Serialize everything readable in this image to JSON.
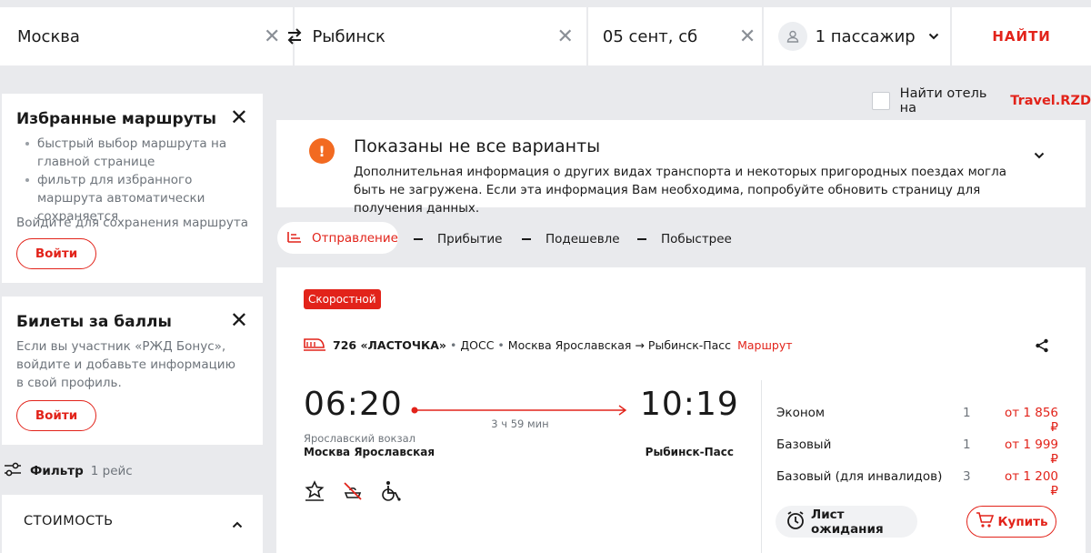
{
  "search": {
    "from": "Москва",
    "to": "Рыбинск",
    "date": "05 сент, сб",
    "passengers": "1 пассажир",
    "find_label": "НАЙТИ"
  },
  "hotel": {
    "label_prefix": "Найти отель на ",
    "brand": "Travel.RZD"
  },
  "favorites": {
    "title": "Избранные маршруты",
    "bullets": [
      "быстрый выбор маршрута на главной странице",
      "фильтр для избранного маршрута автоматически сохраняется"
    ],
    "hint": "Войдите для сохранения маршрута",
    "login_label": "Войти"
  },
  "bonus": {
    "title": "Билеты за баллы",
    "text": "Если вы участник «РЖД Бонус», войдите и добавьте информацию в свой профиль.",
    "login_label": "Войти"
  },
  "filter": {
    "label": "Фильтр",
    "count": "1 рейс"
  },
  "cost_section": {
    "title": "СТОИМОСТЬ"
  },
  "notice": {
    "icon_text": "!",
    "title": "Показаны не все варианты",
    "text": "Дополнительная информация о других видах транспорта и некоторых пригородных поездах могла быть не загружена. Если эта информация Вам необходима, попробуйте обновить страницу для получения данных."
  },
  "sort": {
    "departure": "Отправление",
    "arrival": "Прибытие",
    "cheaper": "Подешевле",
    "faster": "Побыстрее"
  },
  "train": {
    "tag": "Скоростной",
    "number": "726 «ЛАСТОЧКА»",
    "category": "ДОСС",
    "route_from": "Москва Ярославская",
    "route_to": "Рыбинск-Пасс",
    "route_link": "Маршрут",
    "departure_time": "06:20",
    "arrival_time": "10:19",
    "duration": "3 ч 59 мин",
    "departure_station_sub": "Ярославский вокзал",
    "departure_station": "Москва Ярославская",
    "arrival_station": "Рыбинск-Пасс",
    "amenity_icons": [
      "star-hanger-icon",
      "no-food-icon",
      "wheelchair-icon"
    ]
  },
  "tariffs": [
    {
      "name": "Эконом",
      "count": "1",
      "price": "от 1 856 ₽"
    },
    {
      "name": "Базовый",
      "count": "1",
      "price": "от 1 999 ₽"
    },
    {
      "name": "Базовый (для инвалидов)",
      "count": "3",
      "price": "от 1 200 ₽"
    }
  ],
  "actions": {
    "wait_list": "Лист ожидания",
    "buy": "Купить"
  },
  "colors": {
    "accent": "#e2231a",
    "notice": "#f26a21",
    "background": "#e9eaed"
  }
}
